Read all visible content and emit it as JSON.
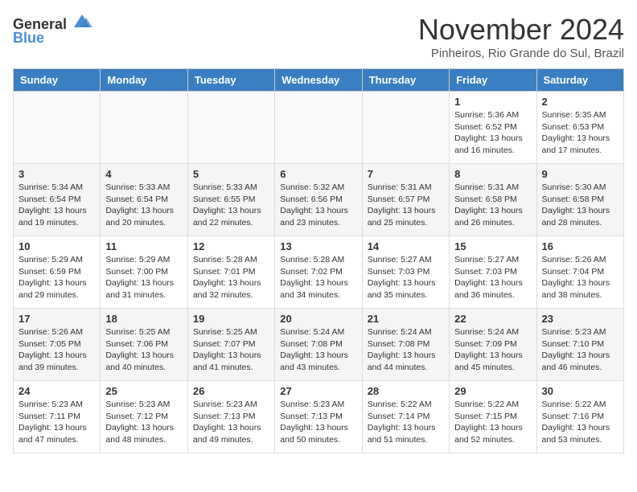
{
  "header": {
    "logo_general": "General",
    "logo_blue": "Blue",
    "month_title": "November 2024",
    "subtitle": "Pinheiros, Rio Grande do Sul, Brazil"
  },
  "days_of_week": [
    "Sunday",
    "Monday",
    "Tuesday",
    "Wednesday",
    "Thursday",
    "Friday",
    "Saturday"
  ],
  "weeks": [
    [
      {
        "day": "",
        "info": ""
      },
      {
        "day": "",
        "info": ""
      },
      {
        "day": "",
        "info": ""
      },
      {
        "day": "",
        "info": ""
      },
      {
        "day": "",
        "info": ""
      },
      {
        "day": "1",
        "info": "Sunrise: 5:36 AM\nSunset: 6:52 PM\nDaylight: 13 hours and 16 minutes."
      },
      {
        "day": "2",
        "info": "Sunrise: 5:35 AM\nSunset: 6:53 PM\nDaylight: 13 hours and 17 minutes."
      }
    ],
    [
      {
        "day": "3",
        "info": "Sunrise: 5:34 AM\nSunset: 6:54 PM\nDaylight: 13 hours and 19 minutes."
      },
      {
        "day": "4",
        "info": "Sunrise: 5:33 AM\nSunset: 6:54 PM\nDaylight: 13 hours and 20 minutes."
      },
      {
        "day": "5",
        "info": "Sunrise: 5:33 AM\nSunset: 6:55 PM\nDaylight: 13 hours and 22 minutes."
      },
      {
        "day": "6",
        "info": "Sunrise: 5:32 AM\nSunset: 6:56 PM\nDaylight: 13 hours and 23 minutes."
      },
      {
        "day": "7",
        "info": "Sunrise: 5:31 AM\nSunset: 6:57 PM\nDaylight: 13 hours and 25 minutes."
      },
      {
        "day": "8",
        "info": "Sunrise: 5:31 AM\nSunset: 6:58 PM\nDaylight: 13 hours and 26 minutes."
      },
      {
        "day": "9",
        "info": "Sunrise: 5:30 AM\nSunset: 6:58 PM\nDaylight: 13 hours and 28 minutes."
      }
    ],
    [
      {
        "day": "10",
        "info": "Sunrise: 5:29 AM\nSunset: 6:59 PM\nDaylight: 13 hours and 29 minutes."
      },
      {
        "day": "11",
        "info": "Sunrise: 5:29 AM\nSunset: 7:00 PM\nDaylight: 13 hours and 31 minutes."
      },
      {
        "day": "12",
        "info": "Sunrise: 5:28 AM\nSunset: 7:01 PM\nDaylight: 13 hours and 32 minutes."
      },
      {
        "day": "13",
        "info": "Sunrise: 5:28 AM\nSunset: 7:02 PM\nDaylight: 13 hours and 34 minutes."
      },
      {
        "day": "14",
        "info": "Sunrise: 5:27 AM\nSunset: 7:03 PM\nDaylight: 13 hours and 35 minutes."
      },
      {
        "day": "15",
        "info": "Sunrise: 5:27 AM\nSunset: 7:03 PM\nDaylight: 13 hours and 36 minutes."
      },
      {
        "day": "16",
        "info": "Sunrise: 5:26 AM\nSunset: 7:04 PM\nDaylight: 13 hours and 38 minutes."
      }
    ],
    [
      {
        "day": "17",
        "info": "Sunrise: 5:26 AM\nSunset: 7:05 PM\nDaylight: 13 hours and 39 minutes."
      },
      {
        "day": "18",
        "info": "Sunrise: 5:25 AM\nSunset: 7:06 PM\nDaylight: 13 hours and 40 minutes."
      },
      {
        "day": "19",
        "info": "Sunrise: 5:25 AM\nSunset: 7:07 PM\nDaylight: 13 hours and 41 minutes."
      },
      {
        "day": "20",
        "info": "Sunrise: 5:24 AM\nSunset: 7:08 PM\nDaylight: 13 hours and 43 minutes."
      },
      {
        "day": "21",
        "info": "Sunrise: 5:24 AM\nSunset: 7:08 PM\nDaylight: 13 hours and 44 minutes."
      },
      {
        "day": "22",
        "info": "Sunrise: 5:24 AM\nSunset: 7:09 PM\nDaylight: 13 hours and 45 minutes."
      },
      {
        "day": "23",
        "info": "Sunrise: 5:23 AM\nSunset: 7:10 PM\nDaylight: 13 hours and 46 minutes."
      }
    ],
    [
      {
        "day": "24",
        "info": "Sunrise: 5:23 AM\nSunset: 7:11 PM\nDaylight: 13 hours and 47 minutes."
      },
      {
        "day": "25",
        "info": "Sunrise: 5:23 AM\nSunset: 7:12 PM\nDaylight: 13 hours and 48 minutes."
      },
      {
        "day": "26",
        "info": "Sunrise: 5:23 AM\nSunset: 7:13 PM\nDaylight: 13 hours and 49 minutes."
      },
      {
        "day": "27",
        "info": "Sunrise: 5:23 AM\nSunset: 7:13 PM\nDaylight: 13 hours and 50 minutes."
      },
      {
        "day": "28",
        "info": "Sunrise: 5:22 AM\nSunset: 7:14 PM\nDaylight: 13 hours and 51 minutes."
      },
      {
        "day": "29",
        "info": "Sunrise: 5:22 AM\nSunset: 7:15 PM\nDaylight: 13 hours and 52 minutes."
      },
      {
        "day": "30",
        "info": "Sunrise: 5:22 AM\nSunset: 7:16 PM\nDaylight: 13 hours and 53 minutes."
      }
    ]
  ]
}
